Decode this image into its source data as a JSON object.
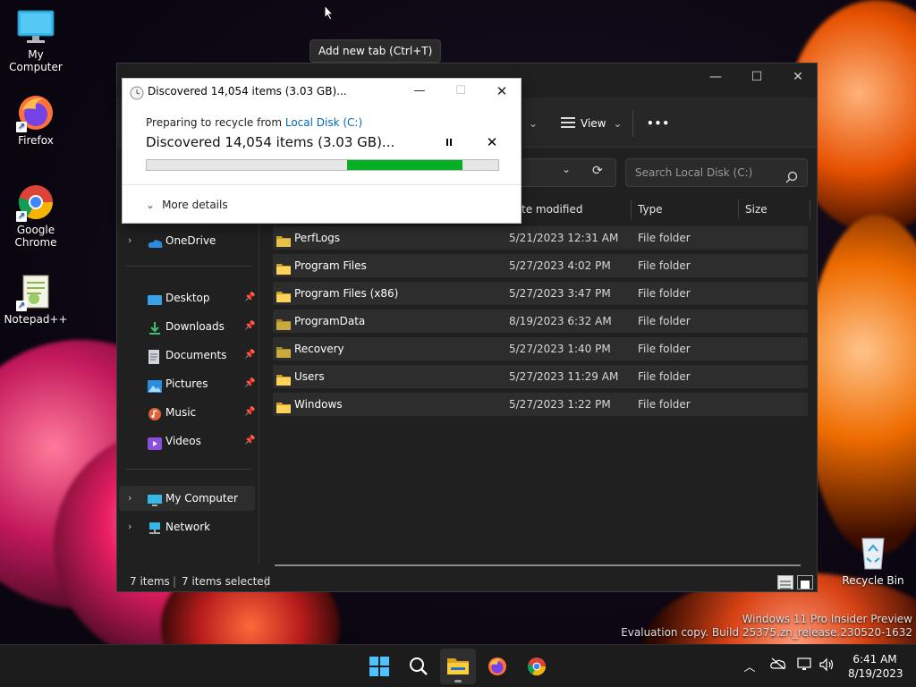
{
  "desktop": {
    "icons": [
      {
        "label": "My Computer"
      },
      {
        "label": "Firefox"
      },
      {
        "label": "Google Chrome"
      },
      {
        "label": "Notepad++"
      }
    ],
    "recycle_bin": "Recycle Bin",
    "watermark_line1": "Windows 11 Pro Insider Preview",
    "watermark_line2": "Evaluation copy. Build 25375.zn_release.230520-1632"
  },
  "tooltip": "Add new tab (Ctrl+T)",
  "explorer": {
    "cmdbar": {
      "view_label": "View",
      "more_label": "•••"
    },
    "search_placeholder": "Search Local Disk (C:)",
    "columns": {
      "date": "te modified",
      "type": "Type",
      "size": "Size"
    },
    "nav": {
      "onedrive": "OneDrive",
      "desktop": "Desktop",
      "downloads": "Downloads",
      "documents": "Documents",
      "pictures": "Pictures",
      "music": "Music",
      "videos": "Videos",
      "my_computer": "My Computer",
      "network": "Network"
    },
    "files": [
      {
        "name": "PerfLogs",
        "date": "5/21/2023 12:31 AM",
        "type": "File folder"
      },
      {
        "name": "Program Files",
        "date": "5/27/2023 4:02 PM",
        "type": "File folder"
      },
      {
        "name": "Program Files (x86)",
        "date": "5/27/2023 3:47 PM",
        "type": "File folder"
      },
      {
        "name": "ProgramData",
        "date": "8/19/2023 6:32 AM",
        "type": "File folder"
      },
      {
        "name": "Recovery",
        "date": "5/27/2023 1:40 PM",
        "type": "File folder"
      },
      {
        "name": "Users",
        "date": "5/27/2023 11:29 AM",
        "type": "File folder"
      },
      {
        "name": "Windows",
        "date": "5/27/2023 1:22 PM",
        "type": "File folder"
      }
    ],
    "status": {
      "items": "7 items",
      "selected": "7 items selected"
    }
  },
  "dialog": {
    "title": "Discovered 14,054 items (3.03 GB)...",
    "preparing_prefix": "Preparing to recycle from ",
    "source_link": "Local Disk (C:)",
    "status": "Discovered 14,054 items (3.03 GB)...",
    "more_details": "More details",
    "progress": {
      "start": 0.57,
      "end": 0.898
    },
    "accent_color": "#06b025"
  },
  "taskbar": {
    "time": "6:41 AM",
    "date": "8/19/2023"
  }
}
